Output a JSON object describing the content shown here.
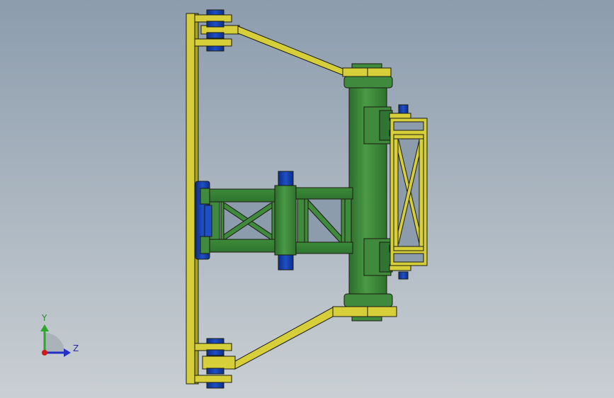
{
  "colors": {
    "background_top": "#8c9cad",
    "background_bottom": "#c9cfd3",
    "frame_yellow": "#d6cf3a",
    "frame_yellow_dark": "#9c9620",
    "body_green": "#3f8a3c",
    "body_green_dark": "#1f4f1f",
    "pin_blue": "#1440a8",
    "pin_blue_dark": "#0a2060",
    "outline": "#1b1b10",
    "axis_y": "#2ea52e",
    "axis_z": "#2230c8",
    "axis_origin": "#d21a1a"
  },
  "view_triad": {
    "y_label": "Y",
    "z_label": "Z",
    "icon": "view-orientation-triad-icon"
  }
}
